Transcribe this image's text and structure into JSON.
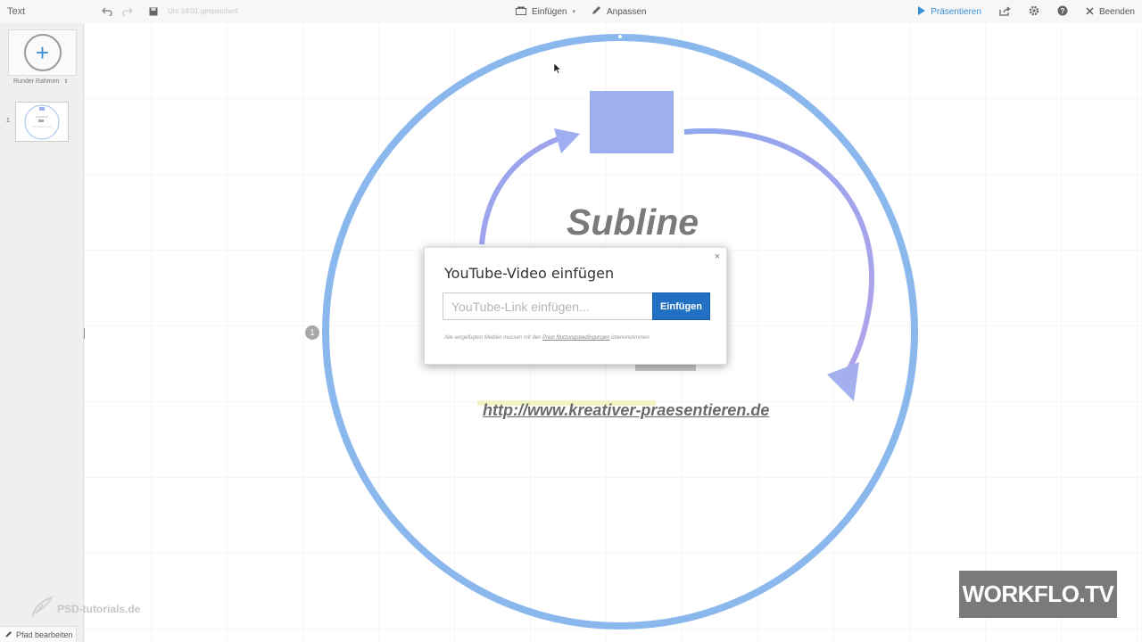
{
  "app": {
    "title": "Text"
  },
  "toolbar": {
    "save_status": "Um 14:01 gespeichert",
    "insert_label": "Einfügen",
    "customize_label": "Anpassen",
    "present_label": "Präsentieren",
    "quit_label": "Beenden",
    "accent_color": "#3a8fd6"
  },
  "sidebar": {
    "frame_type": "Runder Rahmen",
    "slides": [
      {
        "number": "1"
      }
    ],
    "edit_path_label": "Pfad bearbeiten"
  },
  "canvas": {
    "subline": "Subline",
    "url": "http://www.kreativer-praesentieren.de",
    "path_marker": "1",
    "circle_color": "#8ab8ec",
    "box_color": "#9eaff0"
  },
  "dialog": {
    "title": "YouTube-Video einfügen",
    "input_placeholder": "YouTube-Link einfügen...",
    "input_value": "",
    "insert_button": "Einfügen",
    "terms_prefix": "Alle eingefügten Medien müssen mit den",
    "terms_link": "Prezi Nutzungsbedingungen",
    "terms_suffix": "übereinstimmen",
    "close_icon": "×"
  },
  "watermarks": {
    "brand": "WORKFLO.TV",
    "psd": "PSD-tutorials.de"
  }
}
